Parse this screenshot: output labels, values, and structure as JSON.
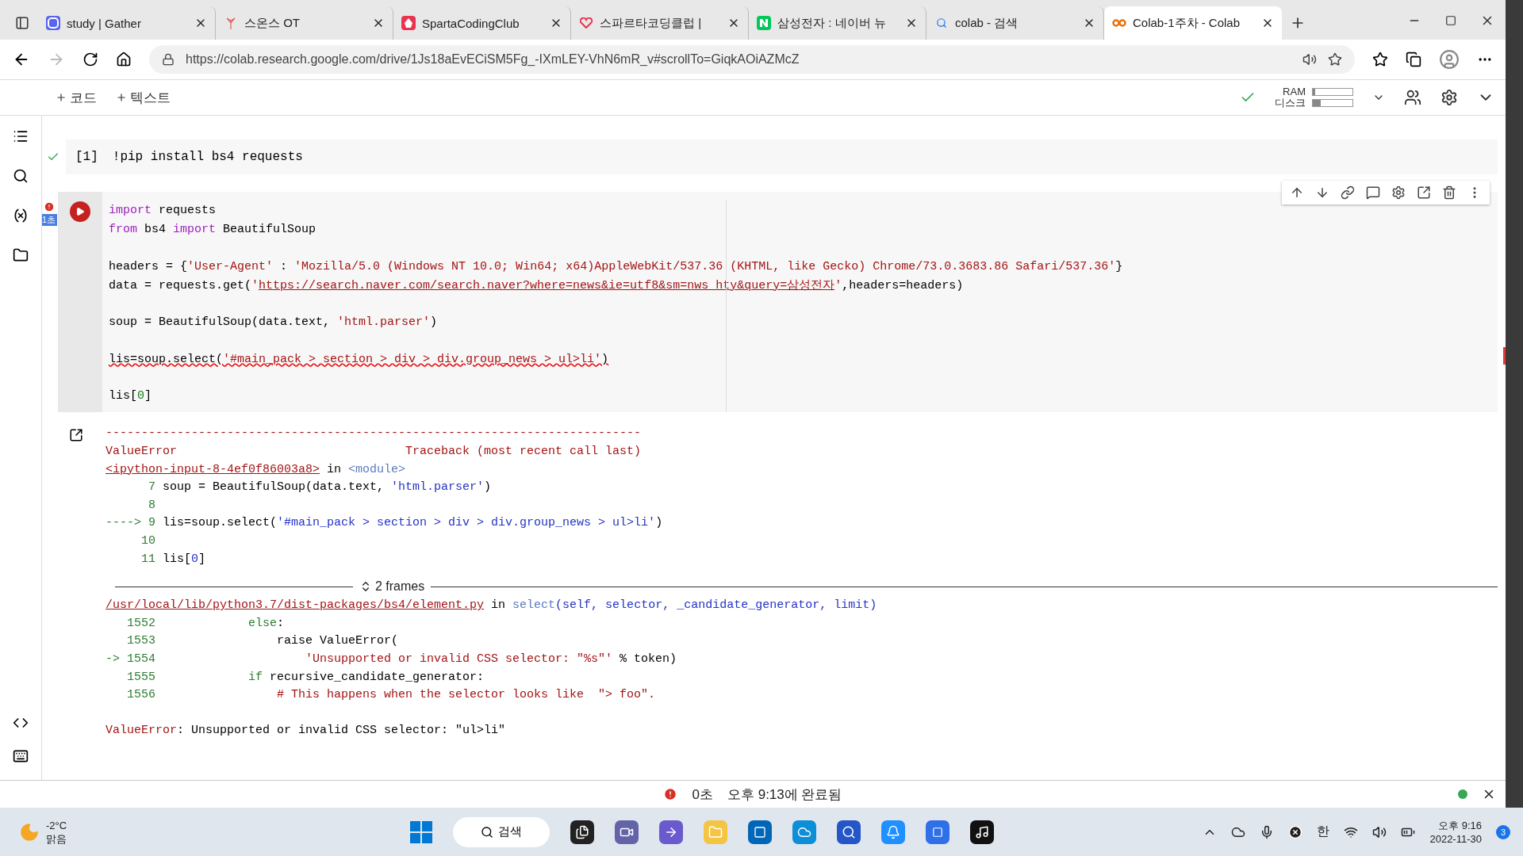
{
  "browser": {
    "tabs": [
      {
        "kind": "gather",
        "title": "study | Gather",
        "selected": false
      },
      {
        "kind": "tulip",
        "title": "스온스 OT",
        "selected": false
      },
      {
        "kind": "sparta",
        "title": "SpartaCodingClub",
        "selected": false
      },
      {
        "kind": "heart",
        "title": "스파르타코딩클럽 |",
        "selected": false
      },
      {
        "kind": "naver",
        "title": "삼성전자 : 네이버 뉴",
        "selected": false
      },
      {
        "kind": "search",
        "title": "colab - 검색",
        "selected": false
      },
      {
        "kind": "colab",
        "title": "Colab-1주차 - Colab",
        "selected": true
      }
    ],
    "url": "https://colab.research.google.com/drive/1Js18aEvECiSM5Fg_-IXmLEY-VhN6mR_v#scrollTo=GiqkAOiAZMcZ"
  },
  "toolbar": {
    "add_code": "코드",
    "add_text": "텍스트",
    "ram_label": "RAM",
    "disk_label": "디스크",
    "ram": {
      "level": 0.05
    },
    "disk": {
      "level": 0.2
    }
  },
  "cells": [
    {
      "kind": "done",
      "count": "[1]",
      "blocks": [
        {
          "lines": [
            {
              "segs": [
                {
                  "text": "!pip install bs4 requests",
                  "kind": "plain"
                }
              ]
            }
          ]
        }
      ]
    },
    {
      "kind": "error",
      "elapsed": "1초",
      "blocks": [
        {
          "lines": [
            {
              "segs": [
                {
                  "text": "import",
                  "kind": "kw"
                },
                {
                  "text": " requests",
                  "kind": "plain"
                }
              ]
            },
            {
              "segs": [
                {
                  "text": "from",
                  "kind": "kw"
                },
                {
                  "text": " bs4 ",
                  "kind": "plain"
                },
                {
                  "text": "import",
                  "kind": "kw"
                },
                {
                  "text": " BeautifulSoup",
                  "kind": "plain"
                }
              ]
            }
          ]
        },
        {
          "lines": [
            {
              "segs": [
                {
                  "text": "headers = {",
                  "kind": "plain"
                },
                {
                  "text": "'User-Agent'",
                  "kind": "str"
                },
                {
                  "text": " : ",
                  "kind": "plain"
                },
                {
                  "text": "'Mozilla/5.0 (Windows NT 10.0; Win64; x64)AppleWebKit/537.36 (KHTML, like Gecko) Chrome/73.0.3683.86 Safari/537.36'",
                  "kind": "str"
                },
                {
                  "text": "}",
                  "kind": "plain"
                }
              ]
            },
            {
              "segs": [
                {
                  "text": "data = requests.get(",
                  "kind": "plain"
                },
                {
                  "text": "'",
                  "kind": "str"
                },
                {
                  "text": "https://search.naver.com/search.naver?where=news&ie=utf8&sm=nws_hty&query=삼성전자",
                  "kind": "link"
                },
                {
                  "text": "'",
                  "kind": "str"
                },
                {
                  "text": ",headers=headers)",
                  "kind": "plain"
                }
              ]
            }
          ]
        },
        {
          "lines": [
            {
              "segs": [
                {
                  "text": "soup = BeautifulSoup(data.text, ",
                  "kind": "plain"
                },
                {
                  "text": "'html.parser'",
                  "kind": "str"
                },
                {
                  "text": ")",
                  "kind": "plain"
                }
              ]
            }
          ]
        },
        {
          "lines": [
            {
              "segs": [
                {
                  "text": "lis=soup.select(",
                  "kind": "squig"
                },
                {
                  "text": "'#main_pack > section > div > div.group_news > ul>li'",
                  "kind": "squigstr"
                },
                {
                  "text": ")",
                  "kind": "squig"
                }
              ]
            }
          ]
        },
        {
          "lines": [
            {
              "segs": [
                {
                  "text": "lis[",
                  "kind": "plain"
                },
                {
                  "text": "0",
                  "kind": "num"
                },
                {
                  "text": "]",
                  "kind": "plain"
                }
              ]
            }
          ]
        }
      ]
    }
  ],
  "output": {
    "before": [
      {
        "lines": [
          {
            "segs": [
              {
                "text": "---------------------------------------------------------------------------",
                "kind": "err"
              }
            ]
          },
          {
            "segs": [
              {
                "text": "ValueError                                Traceback (most recent call last)",
                "kind": "errhead"
              }
            ]
          },
          {
            "segs": [
              {
                "text": "<ipython-input-8-4ef0f86003a8>",
                "kind": "link"
              },
              {
                "text": " in ",
                "kind": "plain"
              },
              {
                "text": "<module>",
                "kind": "muted"
              }
            ]
          },
          {
            "segs": [
              {
                "text": "      7 ",
                "kind": "green"
              },
              {
                "text": "soup = BeautifulSoup(data.text, ",
                "kind": "plain"
              },
              {
                "text": "'html.parser'",
                "kind": "blue"
              },
              {
                "text": ")",
                "kind": "plain"
              }
            ]
          },
          {
            "segs": [
              {
                "text": "      8",
                "kind": "green"
              }
            ]
          },
          {
            "segs": [
              {
                "text": "----> 9 ",
                "kind": "green"
              },
              {
                "text": "lis=soup.select(",
                "kind": "plain"
              },
              {
                "text": "'#main_pack > section > div > div.group_news > ul>li'",
                "kind": "blue"
              },
              {
                "text": ")",
                "kind": "plain"
              }
            ]
          },
          {
            "segs": [
              {
                "text": "     10",
                "kind": "green"
              }
            ]
          },
          {
            "segs": [
              {
                "text": "     11 ",
                "kind": "green"
              },
              {
                "text": "lis[",
                "kind": "plain"
              },
              {
                "text": "0",
                "kind": "blue"
              },
              {
                "text": "]",
                "kind": "plain"
              }
            ]
          }
        ]
      }
    ],
    "frames": "2 frames",
    "after": [
      {
        "lines": [
          {
            "segs": [
              {
                "text": "/usr/local/lib/python3.7/dist-packages/bs4/element.py",
                "kind": "link"
              },
              {
                "text": " in ",
                "kind": "plain"
              },
              {
                "text": "select",
                "kind": "muted"
              },
              {
                "text": "(self, selector, _candidate_generator, limit)",
                "kind": "blue"
              }
            ]
          },
          {
            "segs": [
              {
                "text": "   1552 ",
                "kind": "green"
              },
              {
                "text": "            else",
                "kind": "green"
              },
              {
                "text": ":",
                "kind": "plain"
              }
            ]
          },
          {
            "segs": [
              {
                "text": "   1553 ",
                "kind": "green"
              },
              {
                "text": "                raise ValueError(",
                "kind": "plain"
              }
            ]
          },
          {
            "segs": [
              {
                "text": "-> 1554 ",
                "kind": "green"
              },
              {
                "text": "                    'Unsupported or invalid CSS selector: \"%s\"'",
                "kind": "err"
              },
              {
                "text": " % token)",
                "kind": "plain"
              }
            ]
          },
          {
            "segs": [
              {
                "text": "   1555 ",
                "kind": "green"
              },
              {
                "text": "            if",
                "kind": "green"
              },
              {
                "text": " recursive_candidate_generator",
                "kind": "plain"
              },
              {
                "text": ":",
                "kind": "plain"
              }
            ]
          },
          {
            "segs": [
              {
                "text": "   1556 ",
                "kind": "green"
              },
              {
                "text": "                # This happens when the selector looks like  \"> foo\".",
                "kind": "err"
              }
            ]
          }
        ]
      },
      {
        "lines": [
          {
            "segs": [
              {
                "text": "ValueError",
                "kind": "err"
              },
              {
                "text": ": Unsupported or invalid CSS selector: \"ul>li\"",
                "kind": "plain"
              }
            ]
          }
        ]
      }
    ]
  },
  "status": {
    "elapsed": "0초",
    "message": "오후 9:13에 완료됨"
  },
  "taskbar": {
    "temp": "-2°C",
    "weather": "맑음",
    "search": "검색",
    "ime": "한",
    "time": "오후 9:16",
    "date": "2022-11-30",
    "badge": "3"
  }
}
